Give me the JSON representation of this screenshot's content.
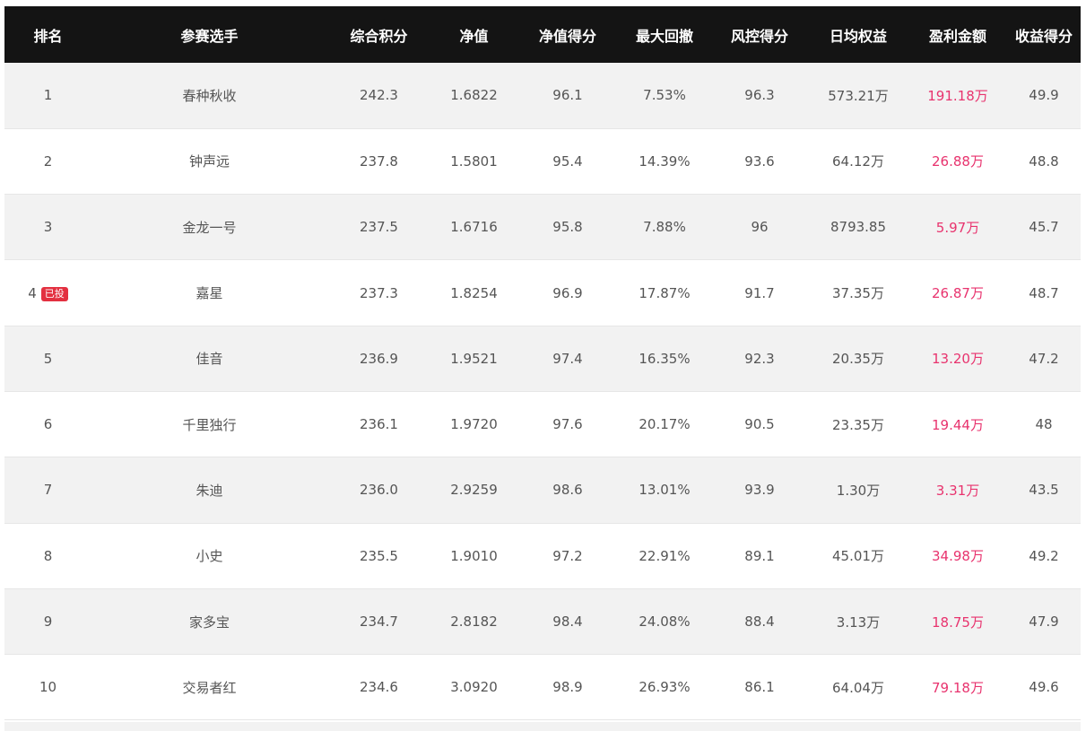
{
  "table": {
    "headers": [
      "排名",
      "参赛选手",
      "综合积分",
      "净值",
      "净值得分",
      "最大回撤",
      "风控得分",
      "日均权益",
      "盈利金额",
      "收益得分"
    ],
    "rows": [
      {
        "rank": "1",
        "badge": "",
        "name": "春种秋收",
        "score": "242.3",
        "nav": "1.6822",
        "nav_score": "96.1",
        "max_drawdown": "7.53%",
        "risk_score": "96.3",
        "avg_equity": "573.21万",
        "profit": "191.18万",
        "return_score": "49.9"
      },
      {
        "rank": "2",
        "badge": "",
        "name": "钟声远",
        "score": "237.8",
        "nav": "1.5801",
        "nav_score": "95.4",
        "max_drawdown": "14.39%",
        "risk_score": "93.6",
        "avg_equity": "64.12万",
        "profit": "26.88万",
        "return_score": "48.8"
      },
      {
        "rank": "3",
        "badge": "",
        "name": "金龙一号",
        "score": "237.5",
        "nav": "1.6716",
        "nav_score": "95.8",
        "max_drawdown": "7.88%",
        "risk_score": "96",
        "avg_equity": "8793.85",
        "profit": "5.97万",
        "return_score": "45.7"
      },
      {
        "rank": "4",
        "badge": "已投",
        "name": "嘉星",
        "score": "237.3",
        "nav": "1.8254",
        "nav_score": "96.9",
        "max_drawdown": "17.87%",
        "risk_score": "91.7",
        "avg_equity": "37.35万",
        "profit": "26.87万",
        "return_score": "48.7"
      },
      {
        "rank": "5",
        "badge": "",
        "name": "佳音",
        "score": "236.9",
        "nav": "1.9521",
        "nav_score": "97.4",
        "max_drawdown": "16.35%",
        "risk_score": "92.3",
        "avg_equity": "20.35万",
        "profit": "13.20万",
        "return_score": "47.2"
      },
      {
        "rank": "6",
        "badge": "",
        "name": "千里独行",
        "score": "236.1",
        "nav": "1.9720",
        "nav_score": "97.6",
        "max_drawdown": "20.17%",
        "risk_score": "90.5",
        "avg_equity": "23.35万",
        "profit": "19.44万",
        "return_score": "48"
      },
      {
        "rank": "7",
        "badge": "",
        "name": "朱迪",
        "score": "236.0",
        "nav": "2.9259",
        "nav_score": "98.6",
        "max_drawdown": "13.01%",
        "risk_score": "93.9",
        "avg_equity": "1.30万",
        "profit": "3.31万",
        "return_score": "43.5"
      },
      {
        "rank": "8",
        "badge": "",
        "name": "小史",
        "score": "235.5",
        "nav": "1.9010",
        "nav_score": "97.2",
        "max_drawdown": "22.91%",
        "risk_score": "89.1",
        "avg_equity": "45.01万",
        "profit": "34.98万",
        "return_score": "49.2"
      },
      {
        "rank": "9",
        "badge": "",
        "name": "家多宝",
        "score": "234.7",
        "nav": "2.8182",
        "nav_score": "98.4",
        "max_drawdown": "24.08%",
        "risk_score": "88.4",
        "avg_equity": "3.13万",
        "profit": "18.75万",
        "return_score": "47.9"
      },
      {
        "rank": "10",
        "badge": "",
        "name": "交易者红",
        "score": "234.6",
        "nav": "3.0920",
        "nav_score": "98.9",
        "max_drawdown": "26.93%",
        "risk_score": "86.1",
        "avg_equity": "64.04万",
        "profit": "79.18万",
        "return_score": "49.6"
      }
    ]
  },
  "colors": {
    "header_bg": "#141414",
    "header_text": "#ffffff",
    "row_alt_bg": "#f2f2f2",
    "profit_text": "#e8336e",
    "badge_bg": "#e33040",
    "cell_text": "#555555"
  }
}
